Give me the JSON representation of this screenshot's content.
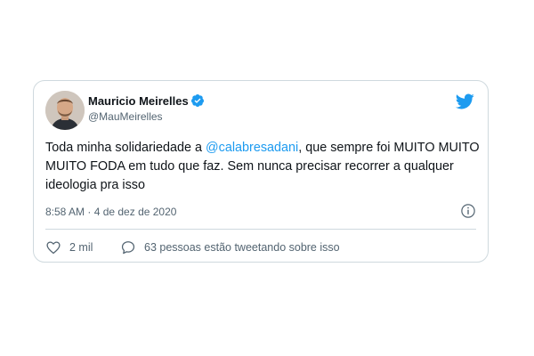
{
  "tweet": {
    "author_name": "Mauricio Meirelles",
    "author_handle": "@MauMeirelles",
    "text_before": "Toda minha solidariedade a ",
    "mention": "@calabresadani",
    "text_after": ", que sempre foi MUITO MUITO MUITO FODA em tudo que faz. Sem nunca precisar recorrer a qualquer ideologia pra isso",
    "timestamp": "8:58 AM · 4 de dez de 2020",
    "likes_label": "2 mil",
    "replies_label": "63 pessoas estão tweetando sobre isso"
  },
  "icons": {
    "brand": "twitter-bird",
    "verified": "verified-badge",
    "info": "info",
    "like": "heart",
    "reply": "speech-bubble"
  },
  "colors": {
    "accent": "#1d9bf0",
    "text": "#0f1419",
    "muted": "#536471",
    "border": "#cfd9de"
  }
}
